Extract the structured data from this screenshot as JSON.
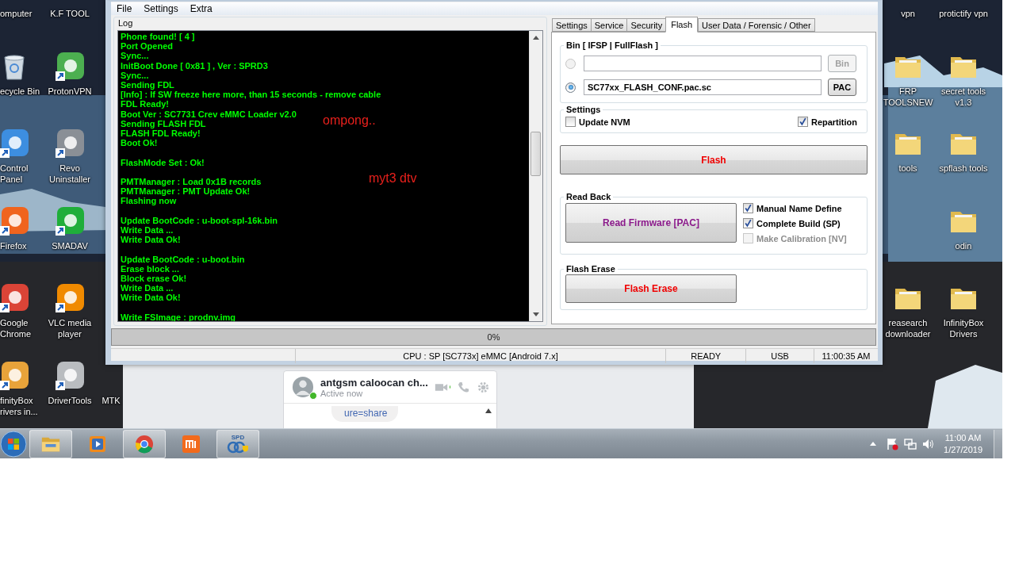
{
  "desktop_icons": [
    {
      "label": "omputer"
    },
    {
      "label": "ecycle Bin",
      "kind": "bin"
    },
    {
      "label": "Control Panel",
      "kind": "app",
      "color": "#3d8ee0"
    },
    {
      "label": "Firefox",
      "kind": "app",
      "color": "#f0641e"
    },
    {
      "label": "Google Chrome",
      "kind": "app",
      "color": "#db4437"
    },
    {
      "label": "finityBox rivers in...",
      "kind": "app",
      "color": "#e8a33a"
    },
    {
      "label": "K.F TOOL"
    },
    {
      "label": "ProtonVPN",
      "kind": "app",
      "color": "#4caf50"
    },
    {
      "label": "Revo Uninstaller",
      "kind": "app",
      "color": "#8a8f96"
    },
    {
      "label": "SMADAV",
      "kind": "app",
      "color": "#1fae3a"
    },
    {
      "label": "VLC media player",
      "kind": "app",
      "color": "#f08a00"
    },
    {
      "label": "DriverTools",
      "kind": "app",
      "color": "#b9bcc0"
    },
    {
      "label": "MTK"
    },
    {
      "label": "vpn"
    },
    {
      "label": "FRP TOOLSNEW",
      "kind": "folder"
    },
    {
      "label": "tools",
      "kind": "folder"
    },
    {
      "label": "reasearch downloader",
      "kind": "folder"
    },
    {
      "label": "protictify vpn"
    },
    {
      "label": "secret tools v1.3",
      "kind": "folder"
    },
    {
      "label": "spflash tools",
      "kind": "folder"
    },
    {
      "label": "odin",
      "kind": "folder"
    },
    {
      "label": "InfinityBox Drivers",
      "kind": "folder"
    }
  ],
  "menu": [
    "File",
    "Settings",
    "Extra"
  ],
  "log": {
    "title": "Log",
    "blocks": [
      [
        "Phone found! [ 4 ]",
        "Port Opened",
        "Sync...",
        "InitBoot Done [ 0x81 ] , Ver : SPRD3",
        "Sync...",
        "Sending FDL",
        "[Info] : If SW freeze here more, than 15 seconds - remove cable",
        "FDL Ready!",
        "Boot Ver : SC7731 Crev eMMC Loader v2.0",
        "Sending FLASH FDL",
        "FLASH FDL Ready!",
        "Boot Ok!"
      ],
      [
        "FlashMode Set : Ok!"
      ],
      [
        "PMTManager : Load 0x1B records",
        "PMTManager : PMT Update Ok!",
        "Flashing now"
      ],
      [
        "Update BootCode : u-boot-spl-16k.bin",
        "Write Data ...",
        "Write Data Ok!"
      ],
      [
        "Update BootCode : u-boot.bin",
        "Erase block ...",
        "Block erase Ok!",
        "Write Data ...",
        "Write Data Ok!"
      ],
      [
        "Write FSImage : prodnv.img"
      ]
    ]
  },
  "annotations": [
    "ompong..",
    "myt3 dtv"
  ],
  "tabs": [
    {
      "label": "Settings",
      "selected": false
    },
    {
      "label": "Service",
      "selected": false
    },
    {
      "label": "Security",
      "selected": false
    },
    {
      "label": "Flash",
      "selected": true
    },
    {
      "label": "User Data / Forensic / Other",
      "selected": false
    }
  ],
  "bin_group": {
    "title": "Bin  [ IFSP | FullFlash ]",
    "rows": [
      {
        "selected": false,
        "disabled": true,
        "button": "Bin"
      },
      {
        "selected": true,
        "disabled": false,
        "value": "SC77xx_FLASH_CONF.pac.sc",
        "button": "PAC"
      }
    ]
  },
  "settings_group": {
    "title": "Settings",
    "options": [
      {
        "label": "Update NVM",
        "checked": false
      },
      {
        "label": "Repartition",
        "checked": true
      }
    ]
  },
  "flash_button": "Flash",
  "read_back": {
    "title": "Read Back",
    "button": "Read Firmware [PAC]",
    "options": [
      {
        "label": "Manual Name Define",
        "checked": true,
        "disabled": false
      },
      {
        "label": "Complete Build (SP)",
        "checked": true,
        "disabled": false
      },
      {
        "label": "Make Calibration [NV]",
        "checked": false,
        "disabled": true
      }
    ]
  },
  "flash_erase": {
    "title": "Flash Erase",
    "button": "Flash Erase"
  },
  "progress": {
    "text": "0%",
    "level": 0
  },
  "status_bar": [
    "CPU : SP [SC773x] eMMC [Android 7.x]",
    "READY",
    "USB",
    "11:00:35 AM"
  ],
  "chat": {
    "title": "antgsm caloocan ch...",
    "status": "Active now",
    "online": true,
    "message": "ure=share"
  },
  "taskbar": {
    "apps": [
      {
        "kind": "folder",
        "running": true
      },
      {
        "kind": "media",
        "running": false
      },
      {
        "kind": "browser",
        "running": true
      },
      {
        "kind": "tile",
        "running": false
      },
      {
        "kind": "tool",
        "running": true,
        "label": "SPD"
      }
    ],
    "clock": {
      "time": "11:00 AM",
      "date": "1/27/2019"
    }
  }
}
